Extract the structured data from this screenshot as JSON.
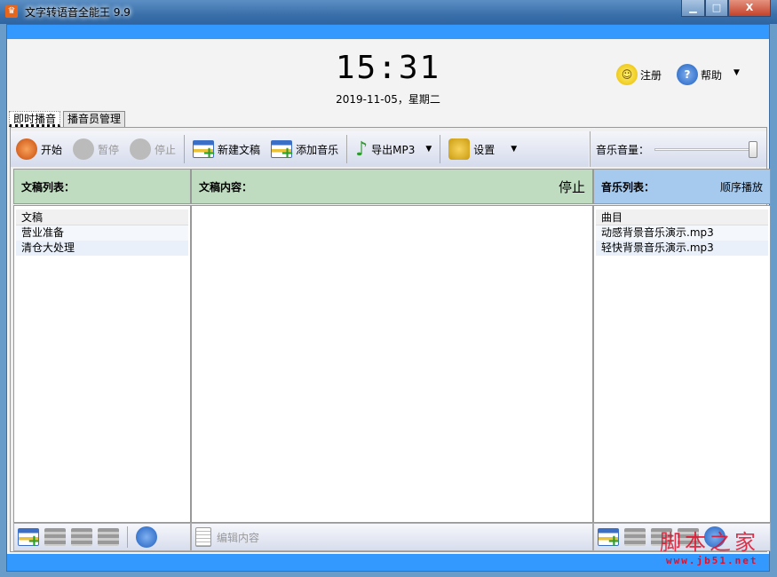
{
  "window": {
    "title": "文字转语音全能王 9.9",
    "minimize": "▁",
    "maximize": "□",
    "close": "X"
  },
  "header": {
    "time": "15:31",
    "date": "2019-11-05，星期二",
    "register": "注册",
    "help": "帮助",
    "menu_arrow": "▼"
  },
  "tabs": [
    {
      "label": "即时播音",
      "active": true
    },
    {
      "label": "播音员管理",
      "active": false
    }
  ],
  "toolbar": {
    "start": "开始",
    "pause": "暂停",
    "stop": "停止",
    "new_doc": "新建文稿",
    "add_music": "添加音乐",
    "export": "导出MP3",
    "settings": "设置",
    "volume_label": "音乐音量：",
    "volume": 1.0
  },
  "doc_list": {
    "title": "文稿列表：",
    "column": "文稿",
    "items": [
      "营业准备",
      "清仓大处理"
    ]
  },
  "doc_content": {
    "title": "文稿内容：",
    "status": "停止",
    "edit": "编辑内容"
  },
  "music_list": {
    "title": "音乐列表：",
    "mode": "顺序播放",
    "column": "曲目",
    "items": [
      "动感背景音乐演示.mp3",
      "轻快背景音乐演示.mp3"
    ]
  },
  "watermark": {
    "text": "脚本之家",
    "url": "www.jb51.net"
  }
}
